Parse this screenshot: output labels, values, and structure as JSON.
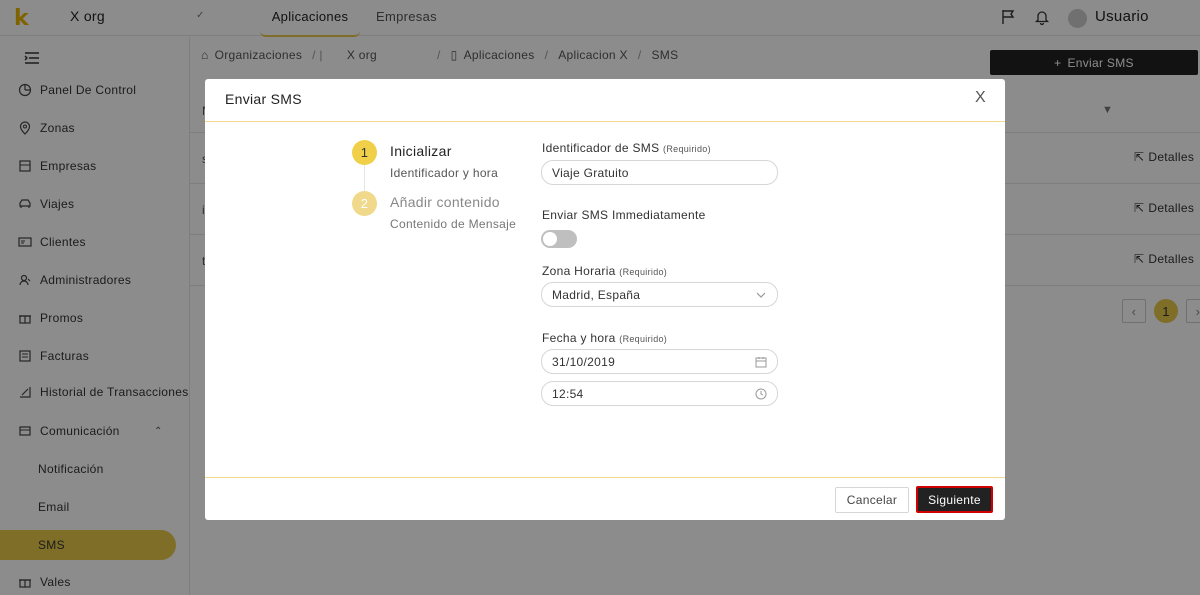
{
  "topbar": {
    "logo": "k",
    "org_name": "X org",
    "tabs": [
      {
        "label": "Aplicaciones"
      },
      {
        "label": "Empresas"
      }
    ],
    "user_name": "Usuario"
  },
  "sidebar": {
    "items": [
      {
        "label": "Panel De Control",
        "icon": "dashboard-icon"
      },
      {
        "label": "Zonas",
        "icon": "location-icon"
      },
      {
        "label": "Empresas",
        "icon": "building-icon"
      },
      {
        "label": "Viajes",
        "icon": "car-icon"
      },
      {
        "label": "Clientes",
        "icon": "id-card-icon"
      },
      {
        "label": "Administradores",
        "icon": "admin-icon"
      },
      {
        "label": "Promos",
        "icon": "gift-icon"
      },
      {
        "label": "Facturas",
        "icon": "invoice-icon"
      },
      {
        "label": "Historial de Transacciones",
        "icon": "history-icon"
      },
      {
        "label": "Comunicación",
        "icon": "communication-icon"
      }
    ],
    "sub_items": [
      {
        "label": "Notificación"
      },
      {
        "label": "Email"
      },
      {
        "label": "SMS"
      }
    ],
    "last_item": {
      "label": "Vales",
      "icon": "voucher-icon"
    }
  },
  "breadcrumb": {
    "items": [
      "Organizaciones",
      "X org",
      "Aplicaciones",
      "Aplicacion X",
      "SMS"
    ]
  },
  "main": {
    "send_button": "Enviar SMS",
    "row_letters": [
      "N",
      "s",
      "i",
      "t"
    ],
    "detail_label": "Detalles",
    "page": "1"
  },
  "modal": {
    "title": "Enviar SMS",
    "close": "X",
    "steps": [
      {
        "number": "1",
        "title": "Inicializar",
        "subtitle": "Identificador y hora"
      },
      {
        "number": "2",
        "title": "Añadir contenido",
        "subtitle": "Contenido de Mensaje"
      }
    ],
    "fields": {
      "sms_id": {
        "label": "Identificador de SMS",
        "required": "(Requirido)",
        "value": "Viaje Gratuito"
      },
      "send_now": {
        "label": "Enviar SMS Immediatamente",
        "enabled": false
      },
      "timezone": {
        "label": "Zona Horaria",
        "required": "(Requirido)",
        "value": "Madrid, España"
      },
      "datetime": {
        "label": "Fecha y hora",
        "required": "(Requirido)",
        "date": "31/10/2019",
        "time": "12:54"
      }
    },
    "cancel_label": "Cancelar",
    "next_label": "Siguiente"
  },
  "colors": {
    "accent": "#e8c84a",
    "step_active": "#f0d048",
    "dark_button": "#222222",
    "highlight_border": "#d10000"
  }
}
